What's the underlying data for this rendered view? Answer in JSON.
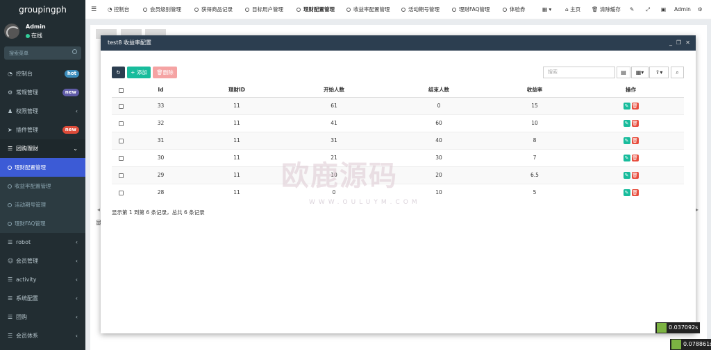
{
  "sidebar": {
    "brand": "groupingph",
    "user": {
      "name": "Admin",
      "status": "在线"
    },
    "search_placeholder": "搜索菜单",
    "items": [
      {
        "label": "控制台",
        "icon": "dashboard-icon",
        "badge": "hot",
        "badge_color": "#3c8dbc"
      },
      {
        "label": "常规管理",
        "icon": "cogs-icon",
        "badge": "new",
        "badge_color": "#605ca8"
      },
      {
        "label": "权限管理",
        "icon": "group-icon"
      },
      {
        "label": "插件管理",
        "icon": "rocket-icon",
        "badge": "new",
        "badge_color": "#dd4b39"
      },
      {
        "label": "团购理财",
        "icon": "list-icon"
      }
    ],
    "subitems": [
      "理财配置管理",
      "收益率配置管理",
      "活动期号管理",
      "理财FAQ管理"
    ],
    "items2": [
      {
        "label": "robot",
        "icon": "list-icon"
      },
      {
        "label": "会员管理",
        "icon": "user-icon"
      },
      {
        "label": "activity",
        "icon": "list-icon"
      },
      {
        "label": "系统配置",
        "icon": "list-icon"
      },
      {
        "label": "团购",
        "icon": "list-icon"
      },
      {
        "label": "会员体系",
        "icon": "list-icon"
      }
    ]
  },
  "topbar": {
    "tabs": [
      "控制台",
      "会员级别管理",
      "获得商品记录",
      "目标用户管理",
      "理财配置管理",
      "收益率配置管理",
      "活动期号管理",
      "理财FAQ管理",
      "体验券"
    ],
    "home": "主页",
    "clear_cache": "清除缓存",
    "admin": "Admin"
  },
  "modal": {
    "title": "test8 收益率配置",
    "add": "添加",
    "delete": "删除",
    "search_placeholder": "搜索",
    "columns": [
      "Id",
      "理财ID",
      "开始人数",
      "结束人数",
      "收益率",
      "操作"
    ],
    "rows": [
      [
        "33",
        "11",
        "61",
        "0",
        "15"
      ],
      [
        "32",
        "11",
        "41",
        "60",
        "10"
      ],
      [
        "31",
        "11",
        "31",
        "40",
        "8"
      ],
      [
        "30",
        "11",
        "21",
        "30",
        "7"
      ],
      [
        "29",
        "11",
        "10",
        "20",
        "6.5"
      ],
      [
        "28",
        "11",
        "0",
        "10",
        "5"
      ]
    ],
    "footer": "显示第 1 到第 6 条记录，总共 6 条记录"
  },
  "background": {
    "text": "显"
  },
  "watermark": {
    "text": "欧鹿源码",
    "url": "WWW.OULUYM.COM"
  },
  "timers": [
    "0.037092s",
    "0.078861s"
  ],
  "colors": {
    "accent": "#3c5bd6",
    "sidebar": "#222d32",
    "add": "#18bc9c",
    "delete": "#f39c9c",
    "edit": "#18bc9c",
    "del": "#e74c3c"
  }
}
